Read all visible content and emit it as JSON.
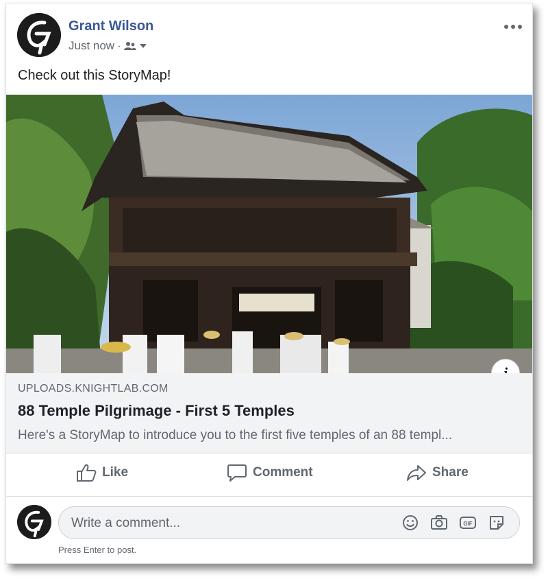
{
  "post": {
    "author": "Grant Wilson",
    "timestamp": "Just now",
    "separator": "·",
    "text": "Check out this StoryMap!"
  },
  "link_preview": {
    "domain": "UPLOADS.KNIGHTLAB.COM",
    "title": "88 Temple Pilgrimage - First 5 Temples",
    "description": "Here's a StoryMap to introduce you to the first five temples of an 88 templ..."
  },
  "actions": {
    "like": "Like",
    "comment": "Comment",
    "share": "Share"
  },
  "comment_box": {
    "placeholder": "Write a comment...",
    "hint": "Press Enter to post."
  },
  "icons": [
    "avatar-logo",
    "friends-icon",
    "chevron-down-icon",
    "more-icon",
    "info-icon",
    "like-icon",
    "comment-icon",
    "share-icon",
    "emoji-icon",
    "camera-icon",
    "gif-icon",
    "sticker-icon"
  ],
  "colors": {
    "author": "#385898",
    "secondary_text": "#606770",
    "link_bg": "#f2f3f5"
  }
}
